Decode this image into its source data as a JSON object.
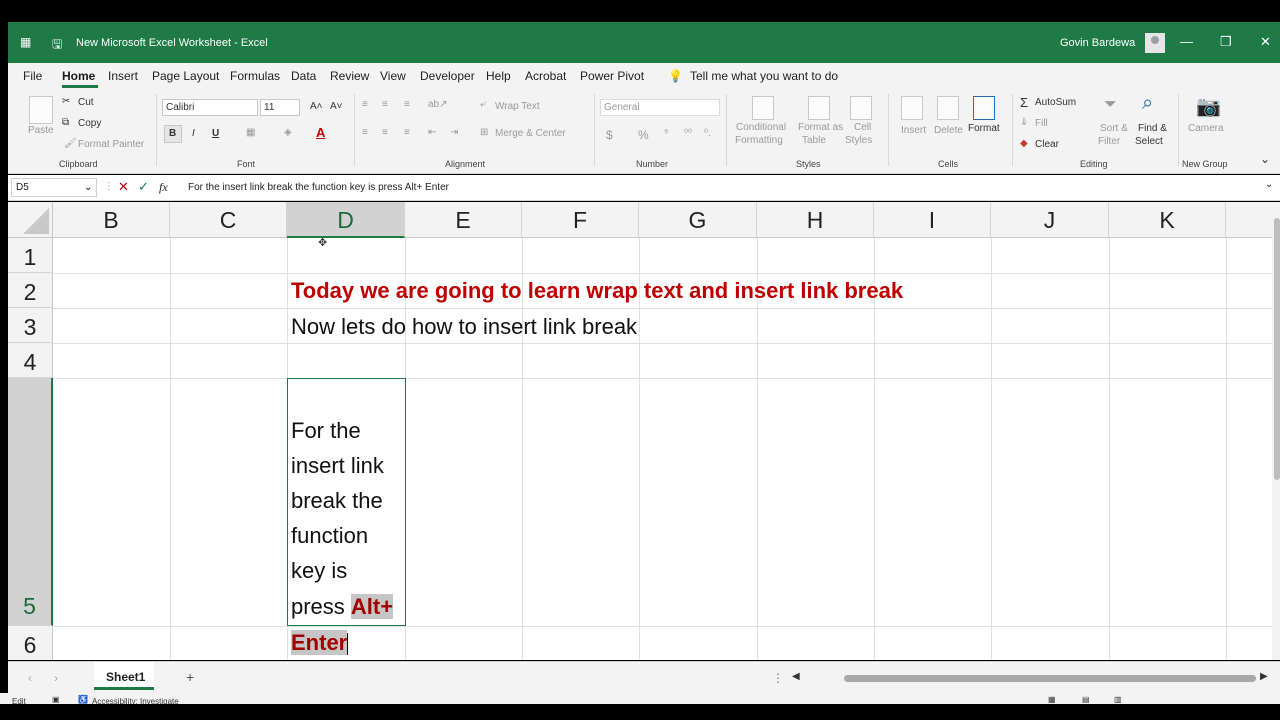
{
  "window": {
    "title": "New Microsoft Excel Worksheet  -  Excel",
    "user": "Govin Bardewa",
    "minimize_glyph": "—",
    "maximize_glyph": "❐",
    "close_glyph": "✕"
  },
  "menu": {
    "items": [
      "File",
      "Home",
      "Insert",
      "Page Layout",
      "Formulas",
      "Data",
      "Review",
      "View",
      "Developer",
      "Help",
      "Acrobat",
      "Power Pivot"
    ],
    "active": "Home",
    "tell_me": "Tell me what you want to do"
  },
  "ribbon": {
    "clipboard": {
      "paste": "Paste",
      "cut": "Cut",
      "copy": "Copy",
      "format_painter": "Format Painter",
      "label": "Clipboard"
    },
    "font": {
      "name": "Calibri",
      "size": "11",
      "bold": "B",
      "italic": "I",
      "underline": "U",
      "font_color_glyph": "A",
      "label": "Font"
    },
    "alignment": {
      "wrap_text": "Wrap Text",
      "merge_center": "Merge & Center",
      "label": "Alignment"
    },
    "number": {
      "format": "General",
      "currency": "$",
      "percent": "%",
      "label": "Number"
    },
    "styles": {
      "conditional": "Conditional",
      "formatting": "Formatting",
      "format_as": "Format as",
      "table": "Table",
      "cell": "Cell",
      "cell_styles": "Styles",
      "label": "Styles"
    },
    "cells": {
      "insert": "Insert",
      "delete": "Delete",
      "format": "Format",
      "label": "Cells"
    },
    "editing": {
      "autosum": "AutoSum",
      "fill": "Fill",
      "clear": "Clear",
      "sort": "Sort &",
      "filter": "Filter",
      "find": "Find &",
      "select": "Select",
      "label": "Editing"
    },
    "new_group": {
      "camera": "Camera",
      "label": "New Group"
    }
  },
  "formula_bar": {
    "name_box": "D5",
    "fx": "fx",
    "content": "For the insert link break the function key is press Alt+ Enter"
  },
  "grid": {
    "columns": [
      "B",
      "C",
      "D",
      "E",
      "F",
      "G",
      "H",
      "I",
      "J",
      "K"
    ],
    "selected_column": "D",
    "rows": [
      "1",
      "2",
      "3",
      "4",
      "5",
      "6"
    ],
    "selected_row": "5",
    "cells": {
      "D2": "Today we are going to learn wrap text and insert link break",
      "D3": "Now lets do how to insert link break",
      "D5_lines": [
        "For the",
        "insert link",
        "break the",
        "function",
        "key is",
        "press "
      ],
      "D5_highlight_1": "Alt+",
      "D5_highlight_2": "Enter"
    }
  },
  "sheet_tabs": {
    "active": "Sheet1",
    "add": "+"
  },
  "status": {
    "mode": "Edit",
    "accessibility": "Accessibility: Investigate"
  },
  "colors": {
    "excel_green": "#1f7a45",
    "red_text": "#c00000",
    "highlight_gray": "#c6c6c6"
  }
}
